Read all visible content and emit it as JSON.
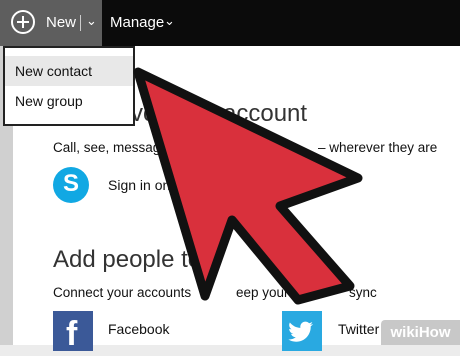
{
  "topbar": {
    "new_label": "New",
    "new_chevron": "⌄",
    "manage_label": "Manage",
    "manage_chevron": "⌄"
  },
  "dropdown": {
    "items": [
      {
        "label": "New contact"
      },
      {
        "label": "New group"
      }
    ]
  },
  "section_account": {
    "heading": "Connect your account",
    "heading_visible": "vc",
    "heading_visible_tail": "account",
    "description_start": "Call, see, messag",
    "description_end": "– wherever they are",
    "skype_label": "Sign in on"
  },
  "section_add": {
    "heading": "Add people to y",
    "description": "Connect your accounts",
    "description_tail": "eep your co",
    "description_end": "sync",
    "facebook_label": "Facebook",
    "twitter_label": "Twitter"
  },
  "watermark": {
    "part1": "wiki",
    "part2": "How"
  },
  "colors": {
    "topbar": "#0b0b0b",
    "new_button_bg": "#5e5e5e",
    "arrow_fill": "#d9303c",
    "arrow_stroke": "#111111",
    "skype": "#11a8e3",
    "facebook": "#3b5998",
    "twitter": "#29a9e1"
  },
  "icons": {
    "new": "plus-circle-icon",
    "skype": "skype-icon",
    "facebook": "facebook-icon",
    "twitter": "twitter-icon"
  }
}
